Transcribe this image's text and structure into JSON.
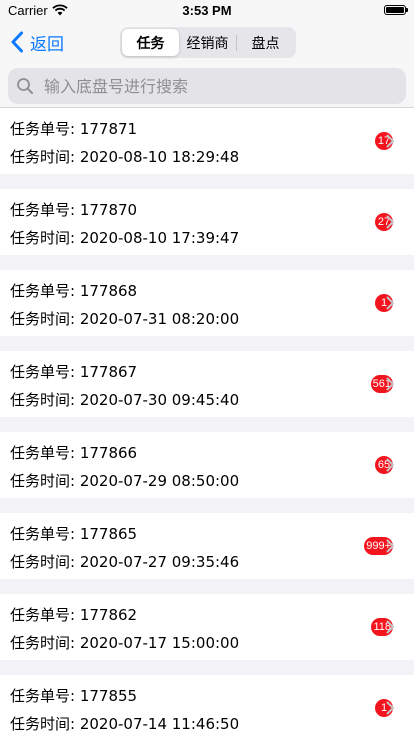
{
  "status_bar": {
    "carrier": "Carrier",
    "time": "3:53 PM"
  },
  "nav": {
    "back_label": "返回",
    "segments": [
      "任务",
      "经销商",
      "盘点"
    ],
    "selected_segment": "任务"
  },
  "search": {
    "placeholder": "输入底盘号进行搜索",
    "value": ""
  },
  "tasks": [
    {
      "number_label": "任务单号: 177871",
      "time_label": "任务时间: 2020-08-10 18:29:48",
      "badge": "17"
    },
    {
      "number_label": "任务单号: 177870",
      "time_label": "任务时间: 2020-08-10 17:39:47",
      "badge": "27"
    },
    {
      "number_label": "任务单号: 177868",
      "time_label": "任务时间: 2020-07-31 08:20:00",
      "badge": "1"
    },
    {
      "number_label": "任务单号: 177867",
      "time_label": "任务时间: 2020-07-30 09:45:40",
      "badge": "561"
    },
    {
      "number_label": "任务单号: 177866",
      "time_label": "任务时间: 2020-07-29 08:50:00",
      "badge": "65"
    },
    {
      "number_label": "任务单号: 177865",
      "time_label": "任务时间: 2020-07-27 09:35:46",
      "badge": "999+"
    },
    {
      "number_label": "任务单号: 177862",
      "time_label": "任务时间: 2020-07-17 15:00:00",
      "badge": "118"
    },
    {
      "number_label": "任务单号: 177855",
      "time_label": "任务时间: 2020-07-14 11:46:50",
      "badge": "1"
    }
  ],
  "colors": {
    "accent": "#0a7aff",
    "badge": "#f4141e",
    "background": "#f2f2f7"
  },
  "icons": {
    "back": "chevron-left-icon",
    "search": "search-icon",
    "row_disclosure": "chevron-right-icon",
    "wifi": "wifi-icon",
    "battery": "battery-icon"
  }
}
